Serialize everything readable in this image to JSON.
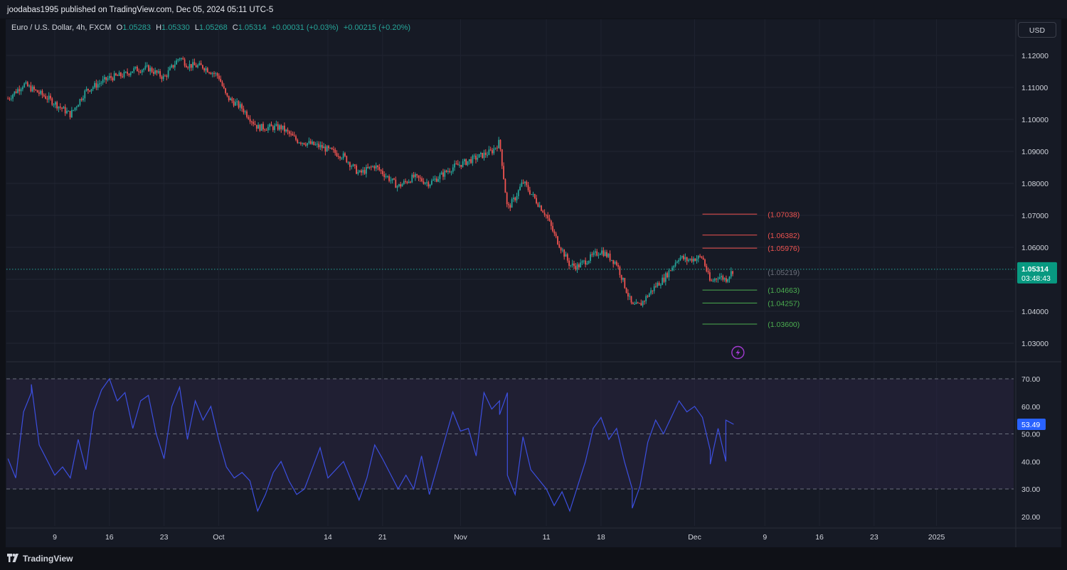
{
  "header": {
    "published_text": "joodabas1995 published on TradingView.com, Dec 05, 2024 05:11 UTC-5",
    "symbol": "Euro / U.S. Dollar, 4h, FXCM",
    "open_label": "O",
    "open": "1.05283",
    "high_label": "H",
    "high": "1.05330",
    "low_label": "L",
    "low": "1.05268",
    "close_label": "C",
    "close": "1.05314",
    "change": "+0.00031 (+0.03%)",
    "change2": "+0.00215 (+0.20%)",
    "currency_button": "USD"
  },
  "footer": {
    "brand": "TradingView"
  },
  "colors": {
    "up": "#26a69a",
    "down": "#ef5350",
    "rsi": "#3c4fe0",
    "rsi_band": "#2a2440",
    "resistance": "#ef5350",
    "support": "#4caf50",
    "price_label_bg": "#089981",
    "rsi_label_bg": "#2962ff",
    "alert_icon": "#a23ad0"
  },
  "chart_data": [
    {
      "type": "candlestick",
      "symbol": "EURUSD",
      "timeframe": "4h",
      "x_ticks": [
        "9",
        "16",
        "23",
        "Oct",
        "14",
        "21",
        "Nov",
        "11",
        "18",
        "Dec",
        "9",
        "16",
        "23",
        "2025"
      ],
      "y_ticks": [
        "1.12000",
        "1.11000",
        "1.10000",
        "1.09000",
        "1.08000",
        "1.07000",
        "1.06000",
        "1.05000",
        "1.04000",
        "1.03000"
      ],
      "ylim": [
        1.0245,
        1.1278
      ],
      "last_price": "1.05314",
      "countdown": "03:48:43",
      "close_path": [
        {
          "x": "2024-09-03",
          "y": 1.1065
        },
        {
          "x": "2024-09-05",
          "y": 1.111
        },
        {
          "x": "2024-09-08",
          "y": 1.1068
        },
        {
          "x": "2024-09-11",
          "y": 1.1015
        },
        {
          "x": "2024-09-13",
          "y": 1.109
        },
        {
          "x": "2024-09-16",
          "y": 1.113
        },
        {
          "x": "2024-09-18",
          "y": 1.114
        },
        {
          "x": "2024-09-19",
          "y": 1.1155
        },
        {
          "x": "2024-09-21",
          "y": 1.116
        },
        {
          "x": "2024-09-23",
          "y": 1.113
        },
        {
          "x": "2024-09-25",
          "y": 1.1195
        },
        {
          "x": "2024-09-26",
          "y": 1.117
        },
        {
          "x": "2024-09-28",
          "y": 1.1165
        },
        {
          "x": "2024-09-30",
          "y": 1.1135
        },
        {
          "x": "2024-10-01",
          "y": 1.107
        },
        {
          "x": "2024-10-03",
          "y": 1.1035
        },
        {
          "x": "2024-10-05",
          "y": 1.0975
        },
        {
          "x": "2024-10-08",
          "y": 1.0975
        },
        {
          "x": "2024-10-10",
          "y": 1.0935
        },
        {
          "x": "2024-10-13",
          "y": 1.0915
        },
        {
          "x": "2024-10-16",
          "y": 1.0885
        },
        {
          "x": "2024-10-18",
          "y": 1.083
        },
        {
          "x": "2024-10-20",
          "y": 1.0855
        },
        {
          "x": "2024-10-23",
          "y": 1.079
        },
        {
          "x": "2024-10-25",
          "y": 1.082
        },
        {
          "x": "2024-10-27",
          "y": 1.08
        },
        {
          "x": "2024-10-30",
          "y": 1.085
        },
        {
          "x": "2024-11-01",
          "y": 1.087
        },
        {
          "x": "2024-11-04",
          "y": 1.09
        },
        {
          "x": "2024-11-05",
          "y": 1.093
        },
        {
          "x": "2024-11-06",
          "y": 1.072
        },
        {
          "x": "2024-11-07",
          "y": 1.0755
        },
        {
          "x": "2024-11-08",
          "y": 1.0805
        },
        {
          "x": "2024-11-11",
          "y": 1.07
        },
        {
          "x": "2024-11-12",
          "y": 1.064
        },
        {
          "x": "2024-11-14",
          "y": 1.0545
        },
        {
          "x": "2024-11-15",
          "y": 1.054
        },
        {
          "x": "2024-11-18",
          "y": 1.059
        },
        {
          "x": "2024-11-20",
          "y": 1.055
        },
        {
          "x": "2024-11-22",
          "y": 1.0415
        },
        {
          "x": "2024-11-23",
          "y": 1.042
        },
        {
          "x": "2024-11-25",
          "y": 1.048
        },
        {
          "x": "2024-11-26",
          "y": 1.05
        },
        {
          "x": "2024-11-28",
          "y": 1.057
        },
        {
          "x": "2024-11-29",
          "y": 1.056
        },
        {
          "x": "2024-12-01",
          "y": 1.057
        },
        {
          "x": "2024-12-02",
          "y": 1.049
        },
        {
          "x": "2024-12-03",
          "y": 1.051
        },
        {
          "x": "2024-12-04",
          "y": 1.05
        },
        {
          "x": "2024-12-05",
          "y": 1.0531
        }
      ],
      "levels": [
        {
          "label": "(1.07038)",
          "value": 1.07038,
          "kind": "resistance"
        },
        {
          "label": "(1.06382)",
          "value": 1.06382,
          "kind": "resistance"
        },
        {
          "label": "(1.05976)",
          "value": 1.05976,
          "kind": "resistance"
        },
        {
          "label": "(1.05219)",
          "value": 1.05219,
          "kind": "pivot"
        },
        {
          "label": "(1.04663)",
          "value": 1.04663,
          "kind": "support"
        },
        {
          "label": "(1.04257)",
          "value": 1.04257,
          "kind": "support"
        },
        {
          "label": "(1.03600)",
          "value": 1.036,
          "kind": "support"
        }
      ]
    },
    {
      "type": "line",
      "indicator": "RSI",
      "y_ticks": [
        "70.00",
        "60.00",
        "50.00",
        "40.00",
        "30.00",
        "20.00"
      ],
      "ylim": [
        15,
        75
      ],
      "overbought": 70,
      "oversold": 30,
      "midline": 50,
      "last_value": "53.49",
      "points": [
        {
          "x": "2024-09-03",
          "y": 41
        },
        {
          "x": "2024-09-04",
          "y": 34
        },
        {
          "x": "2024-09-05",
          "y": 58
        },
        {
          "x": "2024-09-06",
          "y": 65
        },
        {
          "x": "2024-09-06",
          "y": 68
        },
        {
          "x": "2024-09-07",
          "y": 46
        },
        {
          "x": "2024-09-09",
          "y": 35
        },
        {
          "x": "2024-09-10",
          "y": 38
        },
        {
          "x": "2024-09-11",
          "y": 34
        },
        {
          "x": "2024-09-12",
          "y": 48
        },
        {
          "x": "2024-09-13",
          "y": 37
        },
        {
          "x": "2024-09-14",
          "y": 58
        },
        {
          "x": "2024-09-15",
          "y": 66
        },
        {
          "x": "2024-09-16",
          "y": 70
        },
        {
          "x": "2024-09-17",
          "y": 62
        },
        {
          "x": "2024-09-18",
          "y": 65
        },
        {
          "x": "2024-09-19",
          "y": 52
        },
        {
          "x": "2024-09-20",
          "y": 62
        },
        {
          "x": "2024-09-21",
          "y": 64
        },
        {
          "x": "2024-09-22",
          "y": 50
        },
        {
          "x": "2024-09-23",
          "y": 41
        },
        {
          "x": "2024-09-24",
          "y": 60
        },
        {
          "x": "2024-09-25",
          "y": 67
        },
        {
          "x": "2024-09-26",
          "y": 48
        },
        {
          "x": "2024-09-27",
          "y": 62
        },
        {
          "x": "2024-09-28",
          "y": 55
        },
        {
          "x": "2024-09-29",
          "y": 60
        },
        {
          "x": "2024-09-30",
          "y": 48
        },
        {
          "x": "2024-10-01",
          "y": 38
        },
        {
          "x": "2024-10-02",
          "y": 34
        },
        {
          "x": "2024-10-03",
          "y": 36
        },
        {
          "x": "2024-10-04",
          "y": 33
        },
        {
          "x": "2024-10-05",
          "y": 22
        },
        {
          "x": "2024-10-06",
          "y": 28
        },
        {
          "x": "2024-10-07",
          "y": 36
        },
        {
          "x": "2024-10-08",
          "y": 40
        },
        {
          "x": "2024-10-09",
          "y": 33
        },
        {
          "x": "2024-10-10",
          "y": 28
        },
        {
          "x": "2024-10-11",
          "y": 30
        },
        {
          "x": "2024-10-13",
          "y": 45
        },
        {
          "x": "2024-10-14",
          "y": 34
        },
        {
          "x": "2024-10-16",
          "y": 40
        },
        {
          "x": "2024-10-17",
          "y": 33
        },
        {
          "x": "2024-10-18",
          "y": 26
        },
        {
          "x": "2024-10-19",
          "y": 34
        },
        {
          "x": "2024-10-20",
          "y": 46
        },
        {
          "x": "2024-10-21",
          "y": 41
        },
        {
          "x": "2024-10-23",
          "y": 30
        },
        {
          "x": "2024-10-24",
          "y": 35
        },
        {
          "x": "2024-10-25",
          "y": 30
        },
        {
          "x": "2024-10-26",
          "y": 42
        },
        {
          "x": "2024-10-27",
          "y": 28
        },
        {
          "x": "2024-10-29",
          "y": 48
        },
        {
          "x": "2024-10-30",
          "y": 58
        },
        {
          "x": "2024-10-31",
          "y": 51
        },
        {
          "x": "2024-11-01",
          "y": 52
        },
        {
          "x": "2024-11-02",
          "y": 42
        },
        {
          "x": "2024-11-03",
          "y": 65
        },
        {
          "x": "2024-11-04",
          "y": 59
        },
        {
          "x": "2024-11-05",
          "y": 62
        },
        {
          "x": "2024-11-05",
          "y": 57
        },
        {
          "x": "2024-11-06",
          "y": 65
        },
        {
          "x": "2024-11-06",
          "y": 35
        },
        {
          "x": "2024-11-07",
          "y": 28
        },
        {
          "x": "2024-11-08",
          "y": 49
        },
        {
          "x": "2024-11-09",
          "y": 37
        },
        {
          "x": "2024-11-11",
          "y": 30
        },
        {
          "x": "2024-11-12",
          "y": 24
        },
        {
          "x": "2024-11-13",
          "y": 29
        },
        {
          "x": "2024-11-14",
          "y": 22
        },
        {
          "x": "2024-11-15",
          "y": 31
        },
        {
          "x": "2024-11-16",
          "y": 40
        },
        {
          "x": "2024-11-17",
          "y": 52
        },
        {
          "x": "2024-11-18",
          "y": 56
        },
        {
          "x": "2024-11-19",
          "y": 48
        },
        {
          "x": "2024-11-20",
          "y": 52
        },
        {
          "x": "2024-11-21",
          "y": 40
        },
        {
          "x": "2024-11-22",
          "y": 30
        },
        {
          "x": "2024-11-22",
          "y": 23
        },
        {
          "x": "2024-11-23",
          "y": 31
        },
        {
          "x": "2024-11-24",
          "y": 47
        },
        {
          "x": "2024-11-25",
          "y": 55
        },
        {
          "x": "2024-11-26",
          "y": 50
        },
        {
          "x": "2024-11-27",
          "y": 56
        },
        {
          "x": "2024-11-28",
          "y": 62
        },
        {
          "x": "2024-11-29",
          "y": 58
        },
        {
          "x": "2024-11-30",
          "y": 60
        },
        {
          "x": "2024-12-01",
          "y": 56
        },
        {
          "x": "2024-12-02",
          "y": 44
        },
        {
          "x": "2024-12-02",
          "y": 39
        },
        {
          "x": "2024-12-03",
          "y": 52
        },
        {
          "x": "2024-12-04",
          "y": 40
        },
        {
          "x": "2024-12-04",
          "y": 55
        },
        {
          "x": "2024-12-05",
          "y": 53.49
        }
      ]
    }
  ]
}
